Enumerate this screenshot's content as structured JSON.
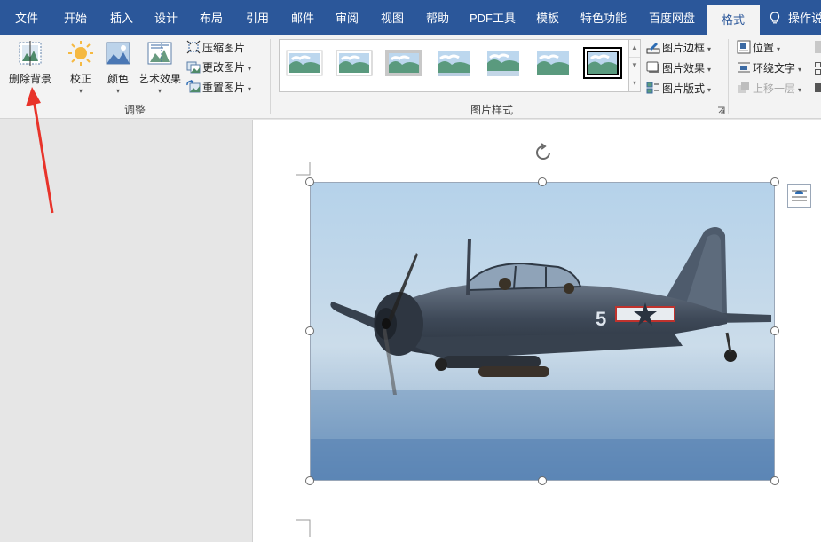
{
  "tabs": [
    "文件",
    "开始",
    "插入",
    "设计",
    "布局",
    "引用",
    "邮件",
    "审阅",
    "视图",
    "帮助",
    "PDF工具",
    "模板",
    "特色功能",
    "百度网盘",
    "格式",
    "操作说"
  ],
  "active_tab": "格式",
  "ribbon": {
    "adjust_group": {
      "label": "调整",
      "remove_background": "删除背景",
      "corrections": "校正",
      "color": "颜色",
      "artistic_effects": "艺术效果",
      "compress_pictures": "压缩图片",
      "change_picture": "更改图片",
      "reset_picture": "重置图片"
    },
    "styles_group": {
      "label": "图片样式",
      "picture_border": "图片边框",
      "picture_effects": "图片效果",
      "picture_layout": "图片版式"
    },
    "arrange_group": {
      "position": "位置",
      "wrap_text": "环绕文字",
      "bring_forward": "上移一层"
    }
  },
  "colors": {
    "tab_bar": "#2b579a",
    "ribbon_bg": "#f3f3f3",
    "annotation_arrow": "#e8332a",
    "doc_background": "#e6e6e6"
  },
  "image": {
    "subject": "airplane photo",
    "marking": "5"
  }
}
